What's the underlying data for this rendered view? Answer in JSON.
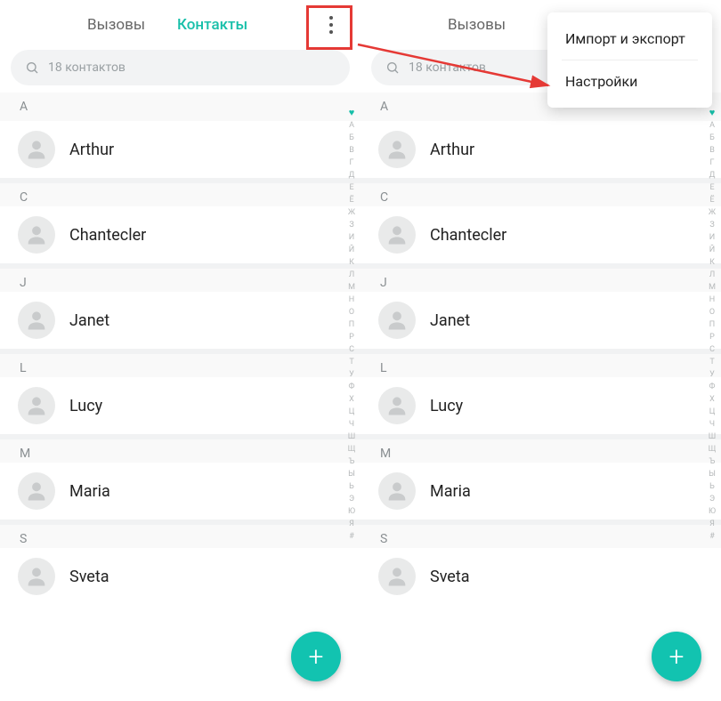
{
  "tabs": {
    "calls": "Вызовы",
    "contacts": "Контакты"
  },
  "search": {
    "placeholder": "18 контактов"
  },
  "sections": [
    {
      "letter": "А",
      "contacts": [
        {
          "name": "Arthur"
        }
      ]
    },
    {
      "letter": "C",
      "contacts": [
        {
          "name": "Chantecler"
        }
      ]
    },
    {
      "letter": "J",
      "contacts": [
        {
          "name": "Janet"
        }
      ]
    },
    {
      "letter": "L",
      "contacts": [
        {
          "name": "Lucy"
        }
      ]
    },
    {
      "letter": "M",
      "contacts": [
        {
          "name": "Maria"
        }
      ]
    },
    {
      "letter": "S",
      "contacts": [
        {
          "name": "Sveta"
        }
      ]
    }
  ],
  "index_letters": [
    "А",
    "Б",
    "В",
    "Г",
    "Д",
    "Е",
    "Ё",
    "Ж",
    "З",
    "И",
    "Й",
    "К",
    "Л",
    "М",
    "Н",
    "О",
    "П",
    "Р",
    "С",
    "Т",
    "У",
    "Ф",
    "Х",
    "Ц",
    "Ч",
    "Ш",
    "Щ",
    "Ъ",
    "Ы",
    "Ь",
    "Э",
    "Ю",
    "Я",
    "#"
  ],
  "fab": {
    "label": "+"
  },
  "menu": {
    "item1": "Импорт и экспорт",
    "item2": "Настройки"
  }
}
